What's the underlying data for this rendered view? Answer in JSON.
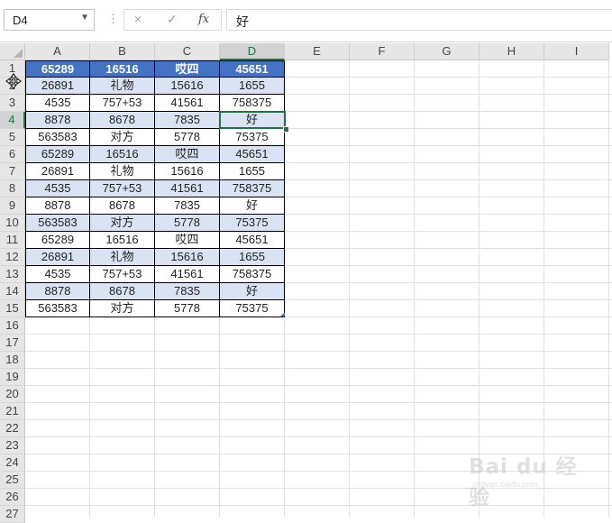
{
  "formula_bar": {
    "name_box": "D4",
    "cancel_icon": "×",
    "enter_icon": "✓",
    "fx_label": "fx",
    "formula_value": "好"
  },
  "columns": [
    "A",
    "B",
    "C",
    "D",
    "E",
    "F",
    "G",
    "H",
    "I"
  ],
  "selected_column": "D",
  "selected_row": 4,
  "row_numbers": [
    "1",
    "2",
    "3",
    "4",
    "5",
    "6",
    "7",
    "8",
    "9",
    "10",
    "11",
    "12",
    "13",
    "14",
    "15",
    "16",
    "17",
    "18",
    "19",
    "20",
    "21",
    "22",
    "23",
    "24",
    "25",
    "26",
    "27"
  ],
  "table": {
    "header": [
      "65289",
      "16516",
      "哎四",
      "45651"
    ],
    "rows": [
      [
        "26891",
        "礼物",
        "15616",
        "1655"
      ],
      [
        "4535",
        "757+53",
        "41561",
        "758375"
      ],
      [
        "8878",
        "8678",
        "7835",
        "好"
      ],
      [
        "563583",
        "对方",
        "5778",
        "75375"
      ],
      [
        "65289",
        "16516",
        "哎四",
        "45651"
      ],
      [
        "26891",
        "礼物",
        "15616",
        "1655"
      ],
      [
        "4535",
        "757+53",
        "41561",
        "758375"
      ],
      [
        "8878",
        "8678",
        "7835",
        "好"
      ],
      [
        "563583",
        "对方",
        "5778",
        "75375"
      ],
      [
        "65289",
        "16516",
        "哎四",
        "45651"
      ],
      [
        "26891",
        "礼物",
        "15616",
        "1655"
      ],
      [
        "4535",
        "757+53",
        "41561",
        "758375"
      ],
      [
        "8878",
        "8678",
        "7835",
        "好"
      ],
      [
        "563583",
        "对方",
        "5778",
        "75375"
      ]
    ]
  },
  "colors": {
    "header_fill": "#4472c4",
    "band_fill": "#dae3f3",
    "selection": "#217346"
  },
  "watermark": {
    "text": "Bai du 经验",
    "url": "jingyan.baidu.com"
  }
}
